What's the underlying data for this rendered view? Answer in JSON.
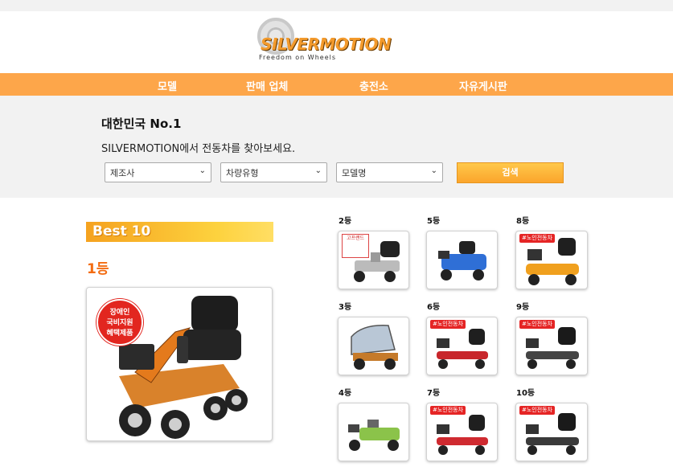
{
  "logo": {
    "brand": "SILVERMOTION",
    "tagline": "Freedom on Wheels"
  },
  "nav": {
    "items": [
      "모델",
      "판매 업체",
      "충전소",
      "자유게시판"
    ]
  },
  "search": {
    "headline": "대한민국 No.1",
    "subline": "SILVERMOTION에서 전동차를 찾아보세요.",
    "filters": [
      "제조사",
      "차량유형",
      "모델명"
    ],
    "button": "검색"
  },
  "best": {
    "banner": "Best 10",
    "top_rank": "1등",
    "top_badge": [
      "장애인",
      "국비지원",
      "혜택제품"
    ],
    "ranks": [
      "2등",
      "5등",
      "8등",
      "3등",
      "6등",
      "9등",
      "4등",
      "7등",
      "10등"
    ],
    "card_tags": {
      "senior": "#노인전동차",
      "product_tag": "고프랜드"
    }
  },
  "colors": {
    "nav": "#fda64a",
    "accent_orange": "#f36c12",
    "panel": "#f2f2f2",
    "button": "#fba52c"
  }
}
